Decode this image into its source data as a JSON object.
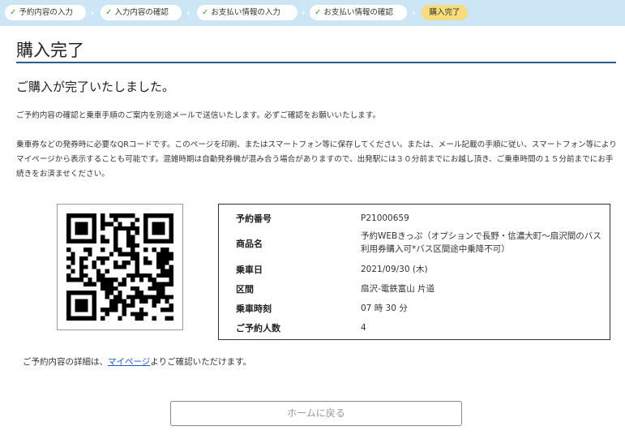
{
  "steps": [
    {
      "label": "予約内容の入力",
      "done": true
    },
    {
      "label": "入力内容の確認",
      "done": true
    },
    {
      "label": "お支払い情報の入力",
      "done": true
    },
    {
      "label": "お支払い情報の確認",
      "done": true
    },
    {
      "label": "購入完了",
      "done": false,
      "active": true
    }
  ],
  "page_title": "購入完了",
  "headline": "ご購入が完了いたしました。",
  "paragraph1": "ご予約内容の確認と乗車手順のご案内を別途メールで送信いたします。必ずご確認をお願いいたします。",
  "paragraph2": "乗車券などの発券時に必要なQRコードです。このページを印刷、またはスマートフォン等に保存してください。または、メール記載の手順に従い、スマートフォン等によりマイページから表示することも可能です。混雑時期は自動発券機が混み合う場合がありますので、出発駅には３０分前までにお越し頂き、ご乗車時間の１５分前までにお手続きをお済ませください。",
  "reservation": {
    "number_label": "予約番号",
    "number_value": "P21000659",
    "product_label": "商品名",
    "product_value": "予約WEBきっぷ（オプションで長野・信濃大町～扇沢間のバス利用券購入可*バス区間途中乗降不可）",
    "date_label": "乗車日",
    "date_value": "2021/09/30 (木)",
    "section_label": "区間",
    "section_value": "扇沢-電鉄富山 片道",
    "time_label": "乗車時刻",
    "time_value": "07 時 30 分",
    "count_label": "ご予約人数",
    "count_value": "4"
  },
  "note": {
    "before": "ご予約内容の詳細は、",
    "link": "マイページ",
    "after": "よりご確認いただけます。"
  },
  "home_button": "ホームに戻る",
  "colors": {
    "step_bar": "#cde6f5",
    "step_active": "#f6dc7a",
    "check": "#3a9a3a",
    "title_rule": "#2c5a8c",
    "link": "#1a56c4"
  },
  "icons": {
    "step_done": "check-icon",
    "step_separator": "chevron-right-icon",
    "qr": "qr-code"
  }
}
